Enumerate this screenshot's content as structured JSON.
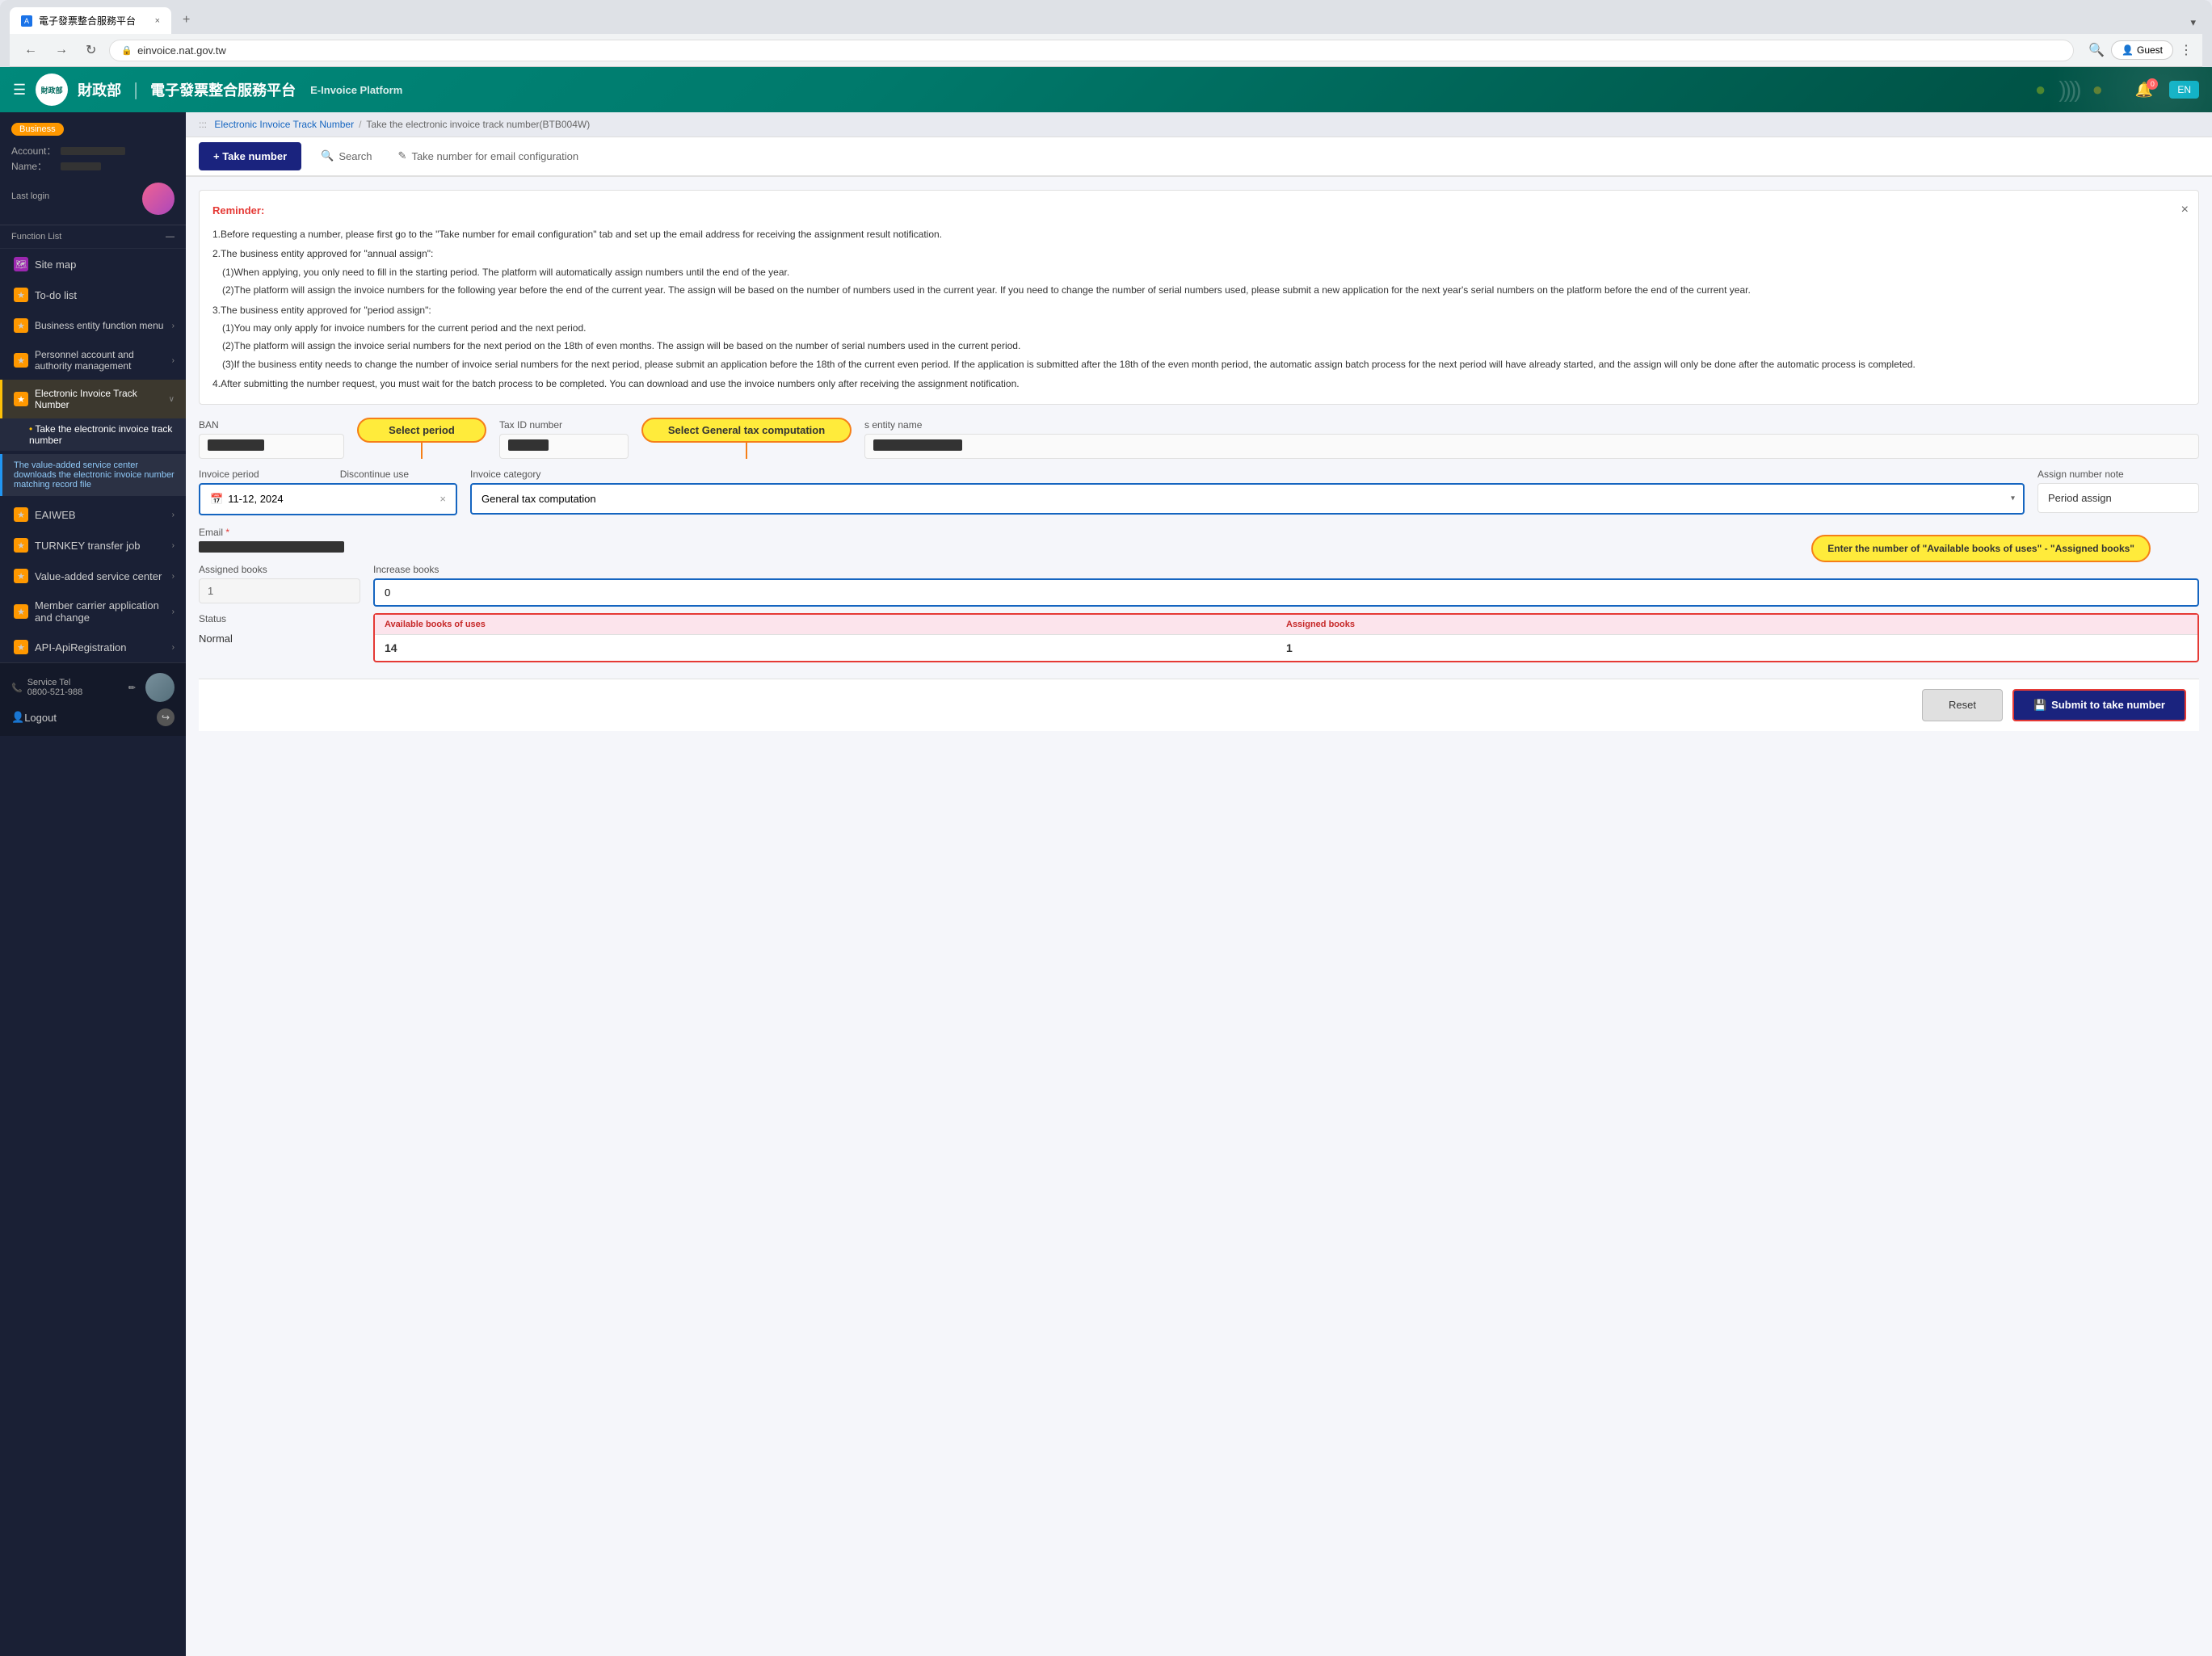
{
  "browser": {
    "tab_title": "電子發票整合服務平台",
    "tab_close": "×",
    "tab_new": "+",
    "address": "einvoice.nat.gov.tw",
    "dropdown_icon": "▾",
    "profile_label": "Guest",
    "back_label": "←",
    "forward_label": "→",
    "reload_label": "↻"
  },
  "topnav": {
    "hamburger": "☰",
    "logo_text": "財政部",
    "separator": "｜",
    "title": "電子發票整合服務平台",
    "subtitle": "E-Invoice Platform",
    "bell_badge": "0",
    "lang_btn": "EN"
  },
  "sidebar": {
    "business_badge": "Business",
    "account_label": "Account：",
    "name_label": "Name：",
    "last_login_label": "Last login",
    "function_list_label": "Function List",
    "collapse_icon": "—",
    "items": [
      {
        "id": "sitemap",
        "label": "Site map",
        "icon": "🗺",
        "icon_class": "icon-purple"
      },
      {
        "id": "todolist",
        "label": "To-do list",
        "icon": "★",
        "icon_class": "icon-orange"
      },
      {
        "id": "bizfunc",
        "label": "Business entity function menu",
        "icon": "★",
        "icon_class": "icon-orange",
        "chevron": "›"
      },
      {
        "id": "personnel",
        "label": "Personnel account and authority management",
        "icon": "★",
        "icon_class": "icon-orange",
        "chevron": "›"
      },
      {
        "id": "einvoice",
        "label": "Electronic Invoice Track Number",
        "icon": "★",
        "icon_class": "icon-orange",
        "chevron": "∨",
        "active": true
      },
      {
        "id": "eaiweb",
        "label": "EAIWEB",
        "icon": "★",
        "icon_class": "icon-orange",
        "chevron": "›"
      },
      {
        "id": "turnkey",
        "label": "TURNKEY transfer job",
        "icon": "★",
        "icon_class": "icon-orange",
        "chevron": "›"
      },
      {
        "id": "valueadded",
        "label": "Value-added service center",
        "icon": "★",
        "icon_class": "icon-orange",
        "chevron": "›"
      },
      {
        "id": "membercarrier",
        "label": "Member carrier application and change",
        "icon": "★",
        "icon_class": "icon-orange",
        "chevron": "›"
      },
      {
        "id": "apiregistration",
        "label": "API-ApiRegistration",
        "icon": "★",
        "icon_class": "icon-orange",
        "chevron": "›"
      }
    ],
    "sub_items": [
      {
        "id": "take_number",
        "label": "Take the electronic invoice track number",
        "active": true
      }
    ],
    "highlight_text": "The value-added service center downloads the electronic invoice number matching record file",
    "service_tel_label": "Service Tel",
    "service_tel": "0800-521-988",
    "pencil_icon": "✏",
    "logout_label": "Logout",
    "logout_icon": "↪"
  },
  "breadcrumb": {
    "separator": "/",
    "items": [
      {
        "label": "Electronic Invoice Track Number",
        "link": true
      },
      {
        "label": "Take the electronic invoice track number(BTB004W)",
        "link": false
      }
    ]
  },
  "tabs": {
    "take_number": "+ Take number",
    "search": "Search",
    "search_icon": "🔍",
    "email_config": "Take number for email configuration",
    "email_icon": "✎"
  },
  "reminder": {
    "title": "Reminder:",
    "close": "×",
    "points": [
      "1.Before requesting a number, please first go to the \"Take number for email configuration\" tab and set up the email address for receiving the assignment result notification.",
      "2.The business entity approved for \"annual assign\":",
      "(1)When applying, you only need to fill in the starting period. The platform will automatically assign numbers until the end of the year.",
      "(2)The platform will assign the invoice numbers for the following year before the end of the current year. The assign will be based on the number of numbers used in the current year. If you need to change the number of serial numbers used, please submit a new application for the next year's serial numbers on the platform before the end of the current year.",
      "3.The business entity approved for \"period assign\":",
      "(1)You may only apply for invoice numbers for the current period and the next period.",
      "(2)The platform will assign the invoice serial numbers for the next period on the 18th of even months. The assign will be based on the number of serial numbers used in the current period.",
      "(3)If the business entity needs to change the number of invoice serial numbers for the next period, please submit an application before the 18th of the current even period. If the application is submitted after the 18th of the even month period, the automatic assign batch process for the next period will have already started, and the assign will only be done after the automatic process is completed.",
      "4.After submitting the number request, you must wait for the batch process to be completed. You can download and use the invoice numbers only after receiving the assignment notification."
    ]
  },
  "form": {
    "ban_label": "BAN",
    "tax_id_label": "Tax ID number",
    "entity_name_label": "s entity name",
    "invoice_period_label": "Invoice period",
    "discontinue_use_label": "Discontinue use",
    "invoice_period_value": "11-12, 2024",
    "invoice_period_clear": "×",
    "invoice_category_label": "Invoice category",
    "invoice_category_value": "General tax computation",
    "assign_number_note_label": "Assign number note",
    "assign_number_note_value": "Period assign",
    "email_label": "Email",
    "email_required": "*",
    "assigned_books_label": "Assigned books",
    "assigned_books_value": "1",
    "increase_books_label": "Increase books",
    "increase_books_value": "0",
    "status_label": "Status",
    "status_value": "Normal",
    "available_books_label": "Available books of uses",
    "available_books_value": "14",
    "assigned_books_table_label": "Assigned books",
    "assigned_books_table_value": "1",
    "annotation_period": "Select period",
    "annotation_category": "Select General tax computation",
    "annotation_books": "Enter the number of \"Available books of uses\" - \"Assigned books\""
  },
  "buttons": {
    "reset": "Reset",
    "submit_icon": "💾",
    "submit": "Submit to take number"
  }
}
